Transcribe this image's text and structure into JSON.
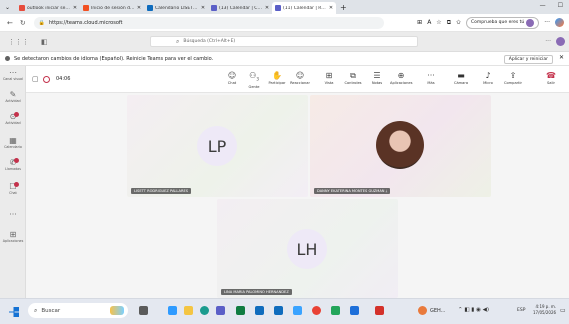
{
  "browser": {
    "tabs": [
      {
        "label": "outlook iniciar sesión - Búsqu",
        "icon": "search-tab-icon",
        "color": "#e74c3c",
        "active": false
      },
      {
        "label": "Inicio de sesión de Outlook | Mi",
        "icon": "microsoft-tab-icon",
        "color": "#f25022",
        "active": false
      },
      {
        "label": "Calendario LISETT RODRIGUEZ",
        "icon": "calendar-tab-icon",
        "color": "#0f6cbd",
        "active": false
      },
      {
        "label": "(13) Calendar | Calendar | Micr",
        "icon": "teams-tab-icon",
        "color": "#5b5fc7",
        "active": false
      },
      {
        "label": "(11) Calendar | Reunión P",
        "icon": "teams-tab-icon",
        "color": "#5b5fc7",
        "active": true
      }
    ],
    "new_tab": "+",
    "url": "https://teams.cloud.microsoft",
    "profile_pill": "Comprueba que eres tú"
  },
  "teams": {
    "search_placeholder": "Búsqueda (Ctrl+Alt+E)",
    "more": "···"
  },
  "notification": {
    "message": "Se detectaron cambios de idioma (Español). Reinicie Teams para ver el cambio.",
    "apply_button": "Aplicar y reiniciar",
    "close": "✕"
  },
  "rail": [
    {
      "label": "Canal visual",
      "icon": "dots-icon"
    },
    {
      "label": "Actividad",
      "icon": "bell-icon",
      "badge": false
    },
    {
      "label": "Actividad",
      "icon": "activity-icon",
      "badge": true
    },
    {
      "label": "Calendario",
      "icon": "calendar-icon",
      "badge": false
    },
    {
      "label": "Llamadas",
      "icon": "phone-icon",
      "badge": true
    },
    {
      "label": "Chat",
      "icon": "chat-icon",
      "badge": true
    },
    {
      "label": "···",
      "icon": "more-icon",
      "badge": false
    },
    {
      "label": "Aplicaciones",
      "icon": "apps-icon",
      "badge": false
    }
  ],
  "meeting": {
    "timer": "04:06",
    "toolbar": [
      {
        "label": "Chat",
        "icon": "☺"
      },
      {
        "label": "Gente",
        "icon": "⚇",
        "count": "3"
      },
      {
        "label": "Participar",
        "icon": "✋"
      },
      {
        "label": "Reaccionar",
        "icon": "☺"
      },
      {
        "label": "Vista",
        "icon": "⊞"
      },
      {
        "label": "Controles",
        "icon": "⧉"
      },
      {
        "label": "Notas",
        "icon": "☰"
      },
      {
        "label": "Aplicaciones",
        "icon": "⊕"
      },
      {
        "label": "Más",
        "icon": "···"
      }
    ],
    "devices": [
      {
        "label": "Cámara",
        "icon": "▬"
      },
      {
        "label": "Micro",
        "icon": "♪"
      },
      {
        "label": "Compartir",
        "icon": "⇪"
      },
      {
        "label": "Salir",
        "icon": "☎"
      }
    ],
    "participants": [
      {
        "initials": "LP",
        "name": "LISETT RODRIGUEZ PALLARES"
      },
      {
        "initials": "",
        "name": "DANNY EKATERINA MONTES GUZMAN"
      },
      {
        "initials": "LH",
        "name": "LINA MARIA PALOMINO HERNANDEZ"
      }
    ],
    "colors": {
      "leave": "#c4314b",
      "accent": "#5b5fc7",
      "record": "#c4314b"
    }
  },
  "taskbar": {
    "search": "Buscar",
    "weather": "GEH...",
    "language": "ESP",
    "time": "4:19 p. m.",
    "date": "17/05/2026"
  }
}
